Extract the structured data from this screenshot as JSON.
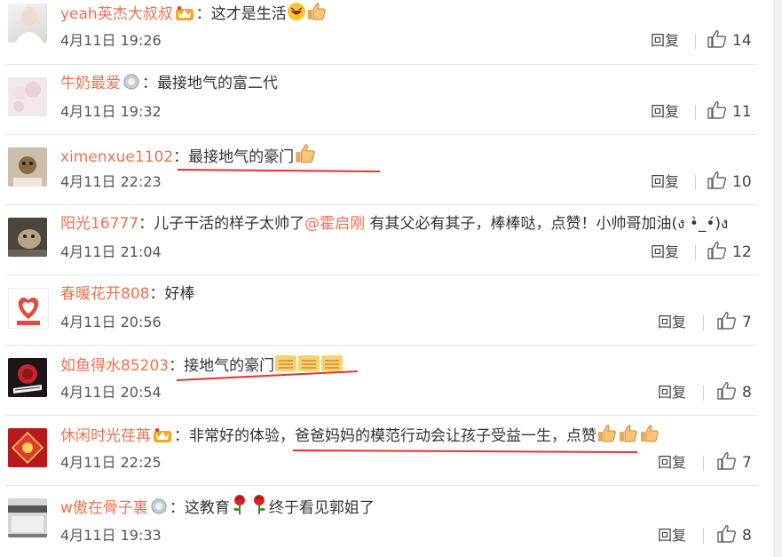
{
  "reply_label": "回复",
  "accent_color": "#eb7350",
  "underline_color": "#e8302d",
  "comments": [
    {
      "user": "yeah英杰大叔叔",
      "badge": "vip-crown-icon",
      "colon": "：",
      "text": "这才是生活",
      "time": "4月11日 19:26",
      "likes": "14"
    },
    {
      "user": "牛奶最爱",
      "badge": "medal-icon",
      "colon": "：",
      "text": "最接地气的富二代",
      "time": "4月11日 19:32",
      "likes": "11"
    },
    {
      "user": "ximenxue1102",
      "colon": "：",
      "text": "最接地气的豪门",
      "time": "4月11日 22:23",
      "likes": "10"
    },
    {
      "user": "阳光16777",
      "colon": "：",
      "text_a": "儿子干活的样子太帅了",
      "mention": "@霍启刚",
      "text_b": " 有其父必有其子，棒棒哒，点赞！小帅哥加油(ง •̀_•́)ง",
      "time": "4月11日 21:04",
      "likes": "12"
    },
    {
      "user": "春暖花开808",
      "colon": "：",
      "text": "好棒",
      "time": "4月11日 20:56",
      "likes": "7"
    },
    {
      "user": "如鱼得水85203",
      "colon": "：",
      "text": "接地气的豪门",
      "time": "4月11日 20:54",
      "likes": "8"
    },
    {
      "user": "休闲时光荏苒",
      "badge": "vip-crown-icon",
      "colon": "：",
      "text": "非常好的体验，爸爸妈妈的模范行动会让孩子受益一生，点赞",
      "time": "4月11日 22:25",
      "likes": "7"
    },
    {
      "user": "w傲在骨子裏",
      "badge": "medal-icon",
      "colon": "：",
      "text_a": "这教育",
      "text_b": "终于看见郭姐了",
      "time": "4月11日 19:33",
      "likes": "8"
    }
  ]
}
